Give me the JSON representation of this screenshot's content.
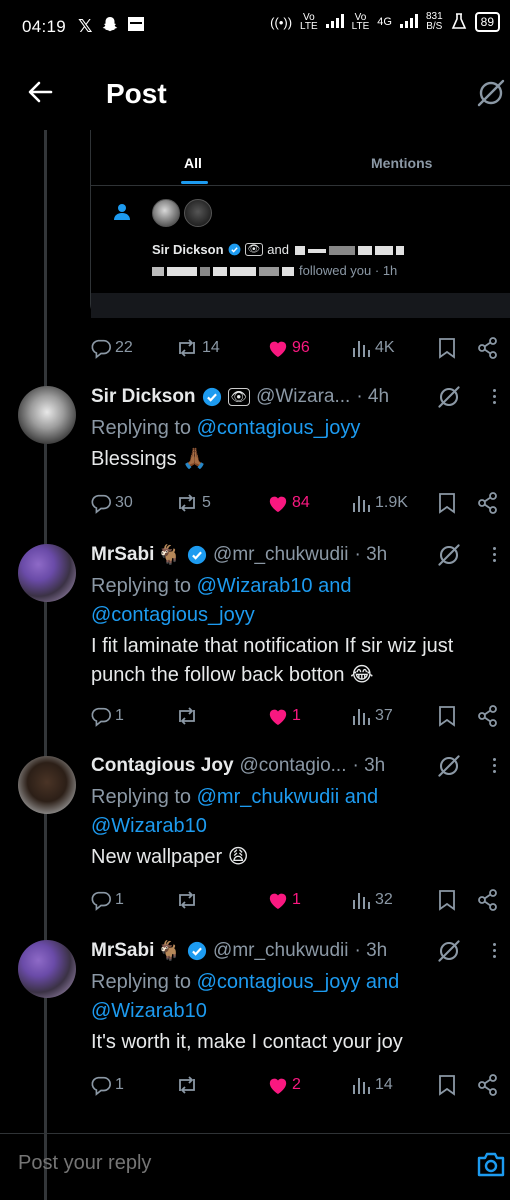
{
  "status_bar": {
    "time": "04:19",
    "vo1": "Vo",
    "lte1": "LTE",
    "vo2": "Vo",
    "lte2": "LTE",
    "net": "4G",
    "speed_value": "831",
    "speed_unit": "B/S",
    "battery": "89"
  },
  "header": {
    "title": "Post"
  },
  "embedded_screenshot": {
    "tabs": [
      "All",
      "Mentions"
    ],
    "notification": {
      "name": "Sir Dickson",
      "and_text": "and",
      "action_text": "followed you · 1h"
    }
  },
  "main_actions": {
    "replies": "22",
    "reposts": "14",
    "likes": "96",
    "views": "4K"
  },
  "posts": [
    {
      "name": "Sir Dickson",
      "emoji": "",
      "handle": "@Wizara...",
      "time": "· 4h",
      "replying_prefix": "Replying to",
      "replying_to": "@contagious_joyy",
      "replying_and": "",
      "replying_to2": "",
      "text": "Blessings 🙏🏾",
      "actions": {
        "replies": "30",
        "reposts": "5",
        "likes": "84",
        "views": "1.9K"
      }
    },
    {
      "name": "MrSabi",
      "emoji": "🐐",
      "handle": "@mr_chukwudii",
      "time": "· 3h",
      "replying_prefix": "Replying to",
      "replying_to": "@Wizarab10",
      "replying_and": "and",
      "replying_to2": "@contagious_joyy",
      "text": "I fit laminate that notification If sir wiz just punch the follow back botton 😂",
      "actions": {
        "replies": "1",
        "reposts": "",
        "likes": "1",
        "views": "37"
      }
    },
    {
      "name": "Contagious Joy",
      "emoji": "",
      "handle": "@contagio...",
      "time": "· 3h",
      "replying_prefix": "Replying to",
      "replying_to": "@mr_chukwudii",
      "replying_and": "and",
      "replying_to2": "@Wizarab10",
      "text": "New wallpaper 😩",
      "actions": {
        "replies": "1",
        "reposts": "",
        "likes": "1",
        "views": "32"
      }
    },
    {
      "name": "MrSabi",
      "emoji": "🐐",
      "handle": "@mr_chukwudii",
      "time": "· 3h",
      "replying_prefix": "Replying to",
      "replying_to": "@contagious_joyy",
      "replying_and": "and",
      "replying_to2": "@Wizarab10",
      "text": "It's worth it, make I contact your joy",
      "actions": {
        "replies": "1",
        "reposts": "",
        "likes": "2",
        "views": "14"
      }
    }
  ],
  "composer": {
    "placeholder": "Post your reply"
  },
  "colors": {
    "accent": "#1d9bf0",
    "like": "#f91880",
    "muted": "#8b98a5",
    "background": "#000000"
  }
}
